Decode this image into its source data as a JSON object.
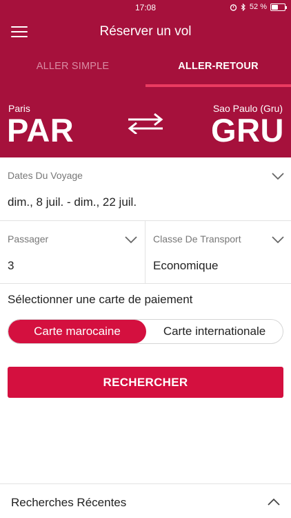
{
  "status_bar": {
    "time": "17:08",
    "battery": "52 %",
    "battery_level": 0.52
  },
  "header": {
    "title": "Réserver un vol",
    "menu_icon": "hamburger-menu-icon"
  },
  "tabs": [
    {
      "label": "ALLER SIMPLE",
      "active": false
    },
    {
      "label": "ALLER-RETOUR",
      "active": true
    }
  ],
  "route": {
    "origin": {
      "city": "Paris",
      "code": "PAR"
    },
    "destination": {
      "city": "Sao Paulo (Gru)",
      "code": "GRU"
    },
    "swap_icon": "swap-arrows-icon"
  },
  "dates": {
    "label": "Dates Du Voyage",
    "value": "dim., 8 juil. - dim., 22 juil."
  },
  "passengers": {
    "label": "Passager",
    "value": "3"
  },
  "travel_class": {
    "label": "Classe De Transport",
    "value": "Economique"
  },
  "payment": {
    "title": "Sélectionner une carte de paiement",
    "options": [
      "Carte marocaine",
      "Carte internationale"
    ],
    "selected": "Carte marocaine"
  },
  "search_button": {
    "label": "RECHERCHER"
  },
  "recent_searches": {
    "label": "Recherches Récentes"
  },
  "colors": {
    "brand": "#a6113c",
    "accent": "#d4103f",
    "tab_indicator": "#ea3b61"
  }
}
